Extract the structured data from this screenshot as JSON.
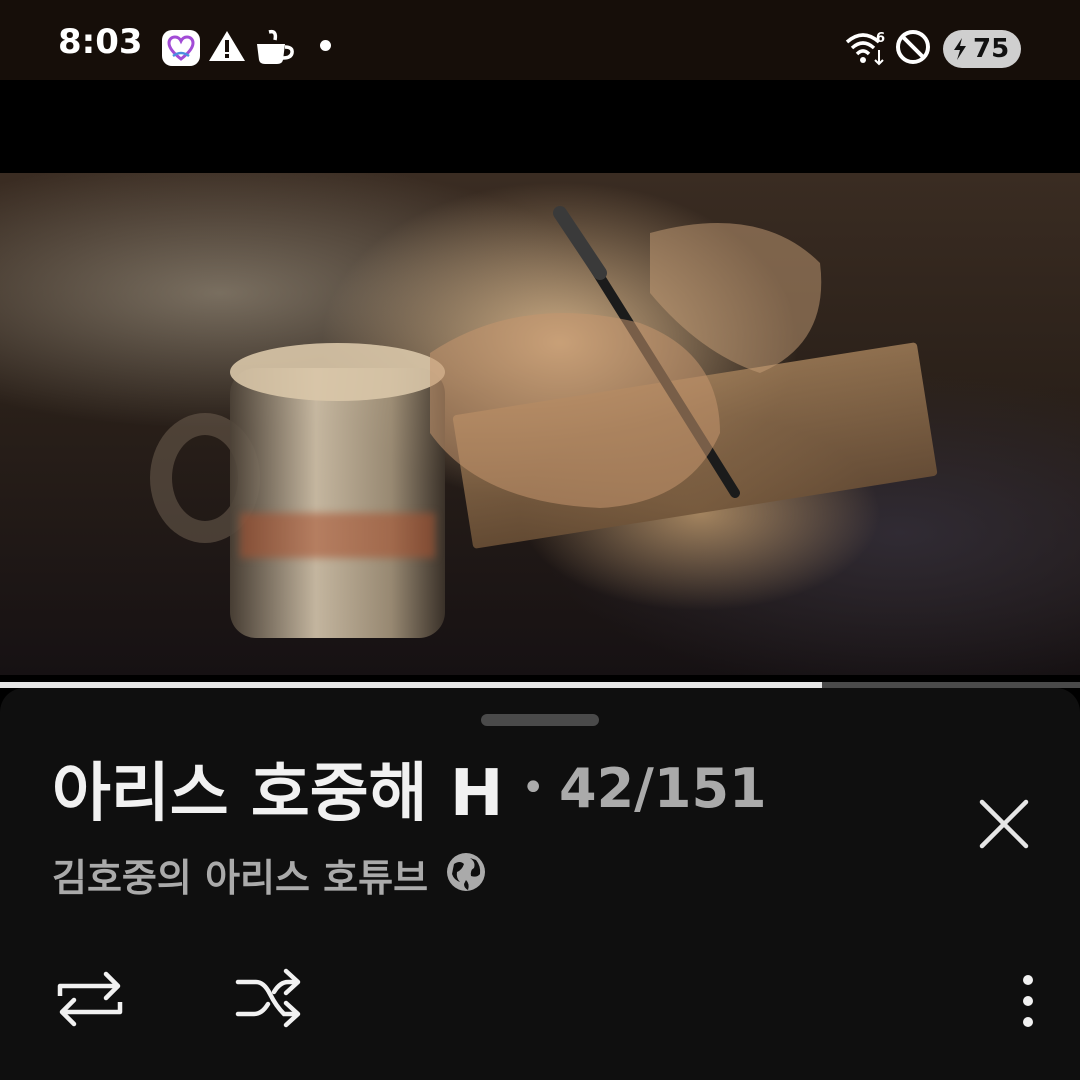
{
  "status_bar": {
    "time": "8:03",
    "battery_level": "75",
    "icons": [
      "app-heart-icon",
      "warning-icon",
      "coffee-icon",
      "notification-dot-icon",
      "wifi-6-icon",
      "do-not-disturb-icon",
      "battery-charging-icon"
    ]
  },
  "player": {
    "progress_fraction": 0.761
  },
  "playlist": {
    "title": "아리스 호중해 H",
    "separator": "•",
    "count": "42/151",
    "channel": "김호중의 아리스 호튜브",
    "visibility_icon": "globe-icon"
  },
  "controls": {
    "icons": [
      "repeat-icon",
      "shuffle-icon",
      "more-vert-icon",
      "close-icon"
    ]
  },
  "colors": {
    "sheet_background": "#0f0f0f",
    "title_text": "#f1f1f1",
    "secondary_text": "#aaaaaa",
    "progress_fill": "#e6e6e6",
    "progress_track": "#4a4a4a"
  }
}
